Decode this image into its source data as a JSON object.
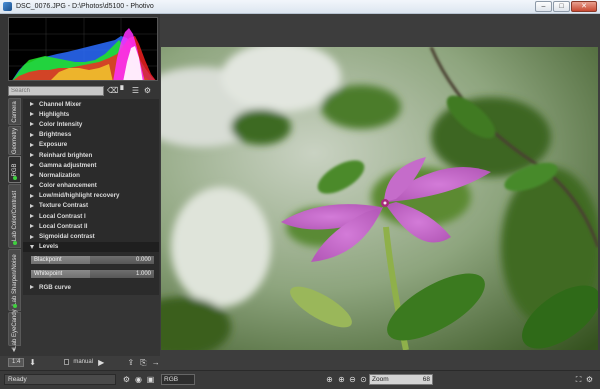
{
  "window": {
    "title": "DSC_0076.JPG - D:\\Photos\\d5100 - Photivo",
    "min_label": "–",
    "max_label": "□",
    "close_label": "✕"
  },
  "search": {
    "placeholder": "Search"
  },
  "tabs": [
    {
      "label": "Camera"
    },
    {
      "label": "Geometry"
    },
    {
      "label": "RGB"
    },
    {
      "label": "Lab Color/Contrast"
    },
    {
      "label": "Lab Sharpen/Noise"
    },
    {
      "label": "Lab EyeCandy"
    }
  ],
  "filters": [
    "Channel Mixer",
    "Highlights",
    "Color Intensity",
    "Brightness",
    "Exposure",
    "Reinhard brighten",
    "Gamma adjustment",
    "Normalization",
    "Color enhancement",
    "Low/mid/highlight recovery",
    "Texture Contrast",
    "Local Contrast I",
    "Local Contrast II",
    "Sigmoidal contrast",
    "Levels"
  ],
  "levels": {
    "blackpoint_label": "Blackpoint",
    "blackpoint_value": "0.000",
    "whitepoint_label": "Whitepoint",
    "whitepoint_value": "1.000"
  },
  "rgb_curve": "RGB curve",
  "bottom": {
    "scale_label": "1:4",
    "manual_label": "manual"
  },
  "status": {
    "text": "Ready",
    "mode": "RGB",
    "zoom_label": "Zoom",
    "zoom_value": "68"
  },
  "colors": {
    "accent": "#3fcf3f",
    "panel": "#2b2b2b"
  }
}
